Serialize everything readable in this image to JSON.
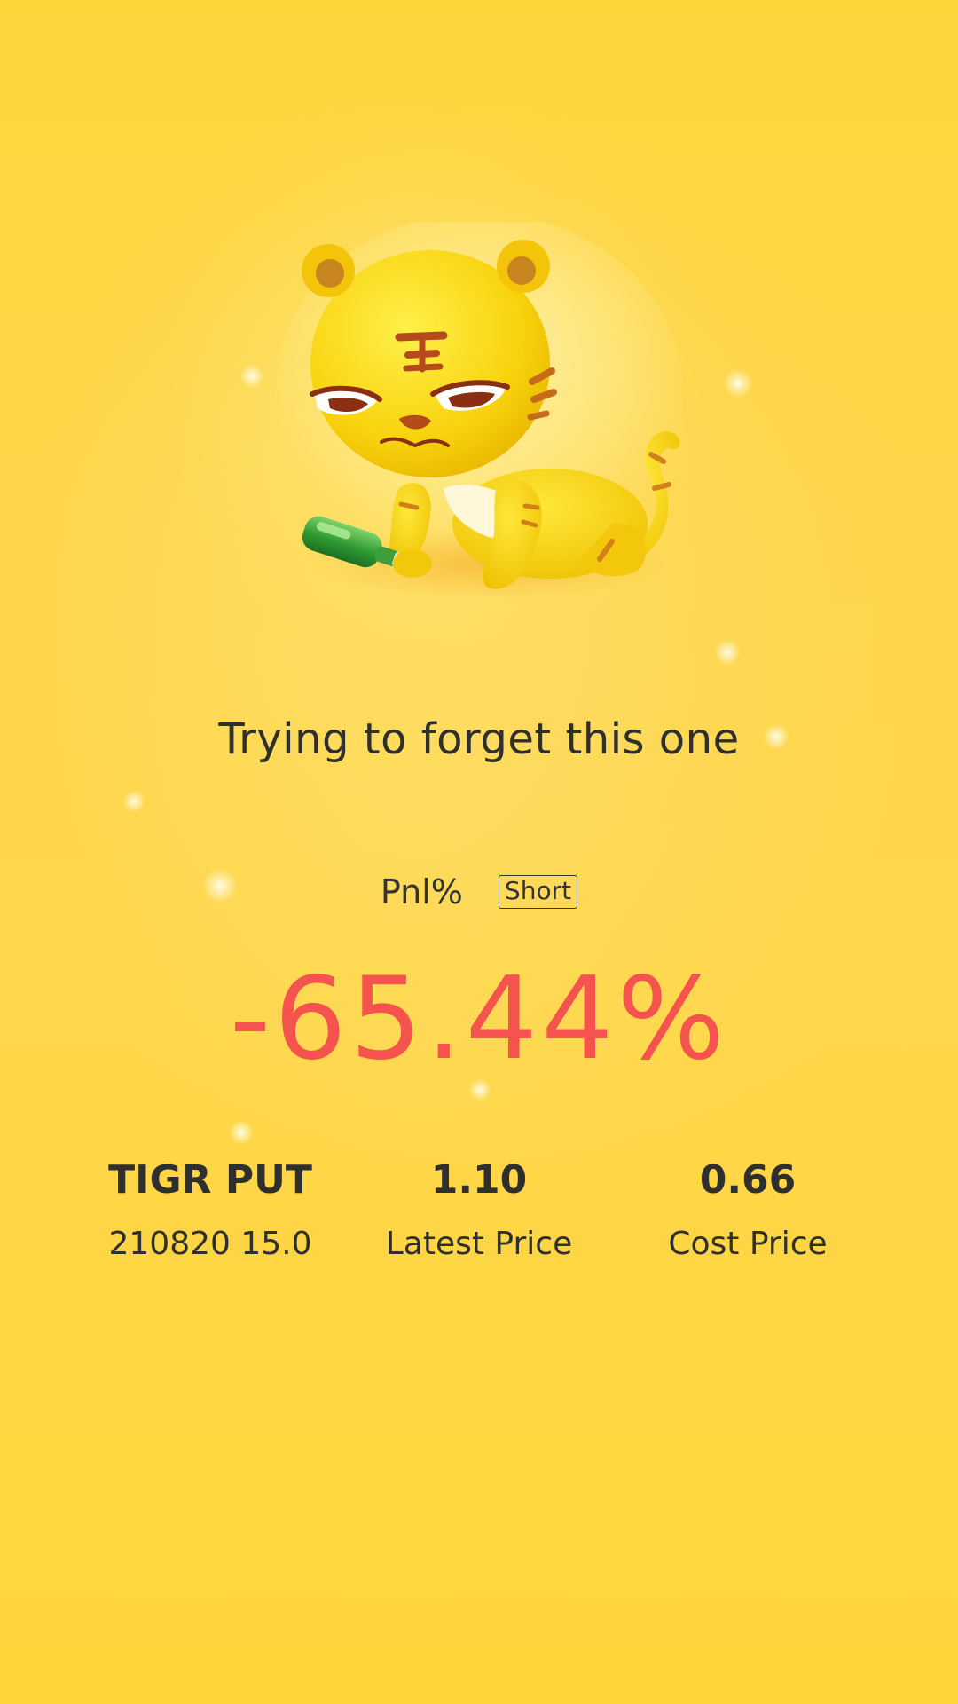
{
  "headline": "Trying to forget this one",
  "pnl": {
    "label": "Pnl%",
    "side_badge": "Short",
    "value": "-65.44%",
    "value_color": "#f4534e"
  },
  "stats": [
    {
      "value": "TIGR PUT",
      "label": "210820 15.0"
    },
    {
      "value": "1.10",
      "label": "Latest Price"
    },
    {
      "value": "0.66",
      "label": "Cost Price"
    }
  ],
  "illustration": {
    "icon": "sad-tiger-mascot-icon"
  },
  "colors": {
    "background": "#fdd63c",
    "text": "#2f2f2f",
    "loss": "#f4534e"
  }
}
